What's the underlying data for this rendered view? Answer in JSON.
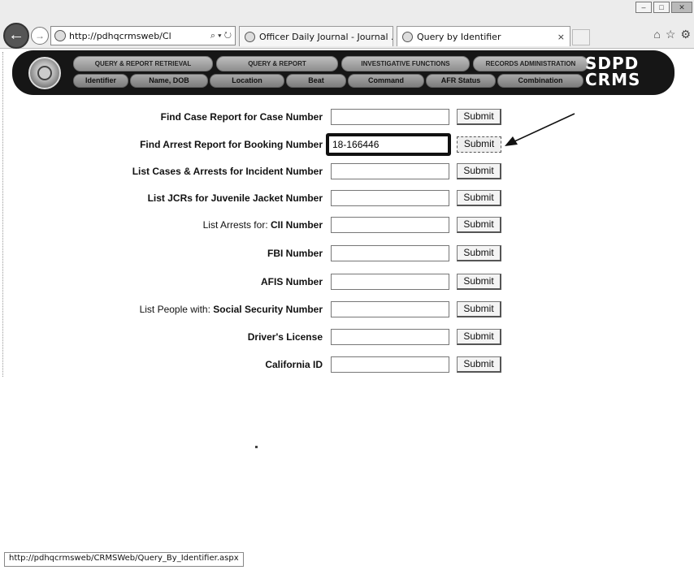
{
  "browser": {
    "address_url": "http://pdhqcrmsweb/Cl",
    "address_controls": "⌕ ▾ ↻",
    "tabs": [
      {
        "title": "Officer Daily Journal - Journal ..."
      },
      {
        "title": "Query by Identifier",
        "close": "×"
      }
    ],
    "window_buttons": {
      "minimize": "–",
      "maximize": "□",
      "close": "✕"
    },
    "right_icons": {
      "home": "⌂",
      "favorites": "☆",
      "tools": "⚙"
    }
  },
  "banner": {
    "logo_line1": "SDPD",
    "logo_line2": "CRMS",
    "menu_top": [
      "Query & Report Retrieval",
      "Query & Report",
      "Investigative Functions",
      "Records Administration"
    ],
    "menu_bottom": [
      "Identifier",
      "Name, DOB",
      "Location",
      "Beat",
      "Command",
      "AFR Status",
      "Combination"
    ]
  },
  "form": {
    "rows": [
      {
        "prefix": "",
        "label": "Find Case Report for Case Number",
        "value": "",
        "button": "Submit"
      },
      {
        "prefix": "",
        "label": "Find Arrest Report for Booking Number",
        "value": "18-166446",
        "button": "Submit"
      },
      {
        "prefix": "",
        "label": "List Cases & Arrests for Incident Number",
        "value": "",
        "button": "Submit"
      },
      {
        "prefix": "",
        "label": "List JCRs for Juvenile Jacket Number",
        "value": "",
        "button": "Submit"
      },
      {
        "prefix": "List Arrests for: ",
        "label": "CII Number",
        "value": "",
        "button": "Submit"
      },
      {
        "prefix": "",
        "label": "FBI Number",
        "value": "",
        "button": "Submit"
      },
      {
        "prefix": "",
        "label": "AFIS Number",
        "value": "",
        "button": "Submit"
      },
      {
        "prefix": "List People with: ",
        "label": "Social Security Number",
        "value": "",
        "button": "Submit"
      },
      {
        "prefix": "",
        "label": "Driver's License",
        "value": "",
        "button": "Submit"
      },
      {
        "prefix": "",
        "label": "California ID",
        "value": "",
        "button": "Submit"
      }
    ]
  },
  "status_bar": "http://pdhqcrmsweb/CRMSWeb/Query_By_Identifier.aspx"
}
